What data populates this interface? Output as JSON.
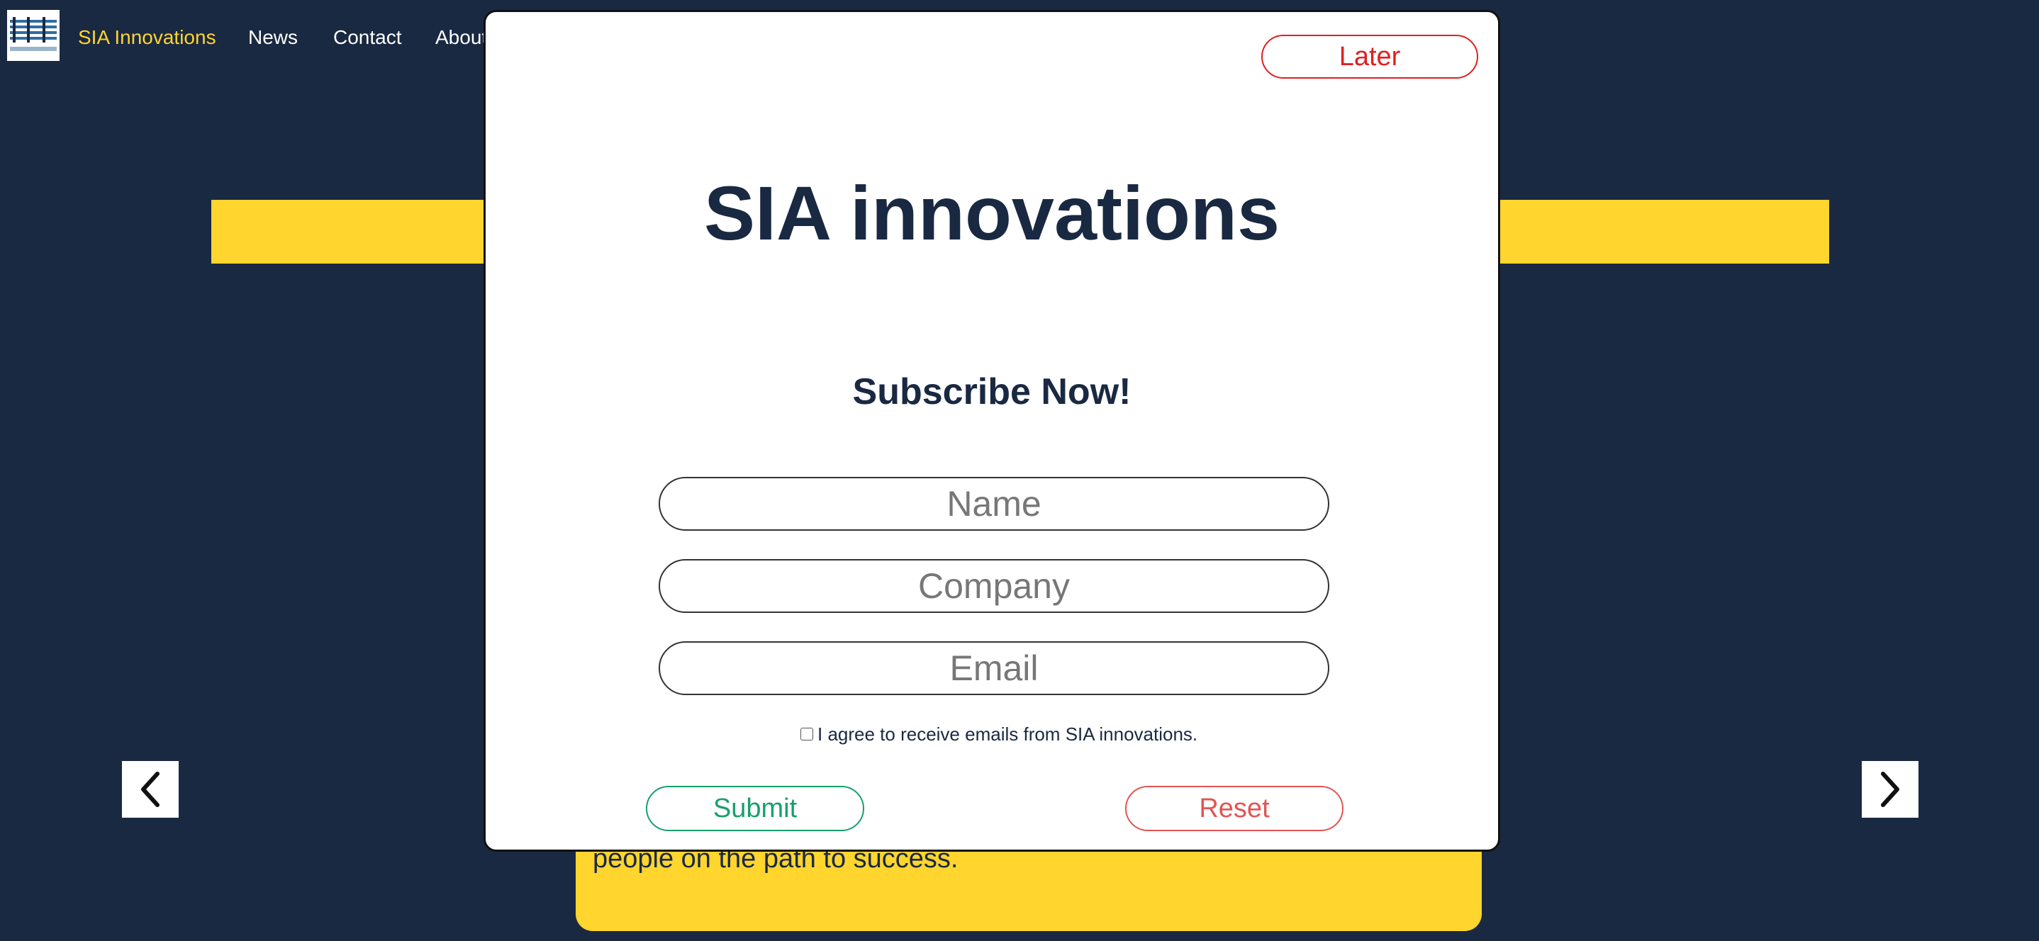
{
  "nav": {
    "brand": "SIA Innovations",
    "links": [
      "News",
      "Contact",
      "About"
    ]
  },
  "hero": {
    "title": "SIA innovations"
  },
  "card": {
    "text": "people on the path to success."
  },
  "modal": {
    "later_label": "Later",
    "title": "SIA innovations",
    "subtitle": "Subscribe Now!",
    "fields": {
      "name_placeholder": "Name",
      "company_placeholder": "Company",
      "email_placeholder": "Email"
    },
    "agree_label": "I agree to receive emails from SIA innovations.",
    "agree_checked": false,
    "submit_label": "Submit",
    "reset_label": "Reset"
  },
  "colors": {
    "background": "#1a2942",
    "accent_yellow": "#ffd52e",
    "later_red": "#e02020",
    "submit_green": "#17a06d",
    "reset_red": "#e25454"
  },
  "icons": {
    "prev": "chevron-left-icon",
    "next": "chevron-right-icon"
  }
}
